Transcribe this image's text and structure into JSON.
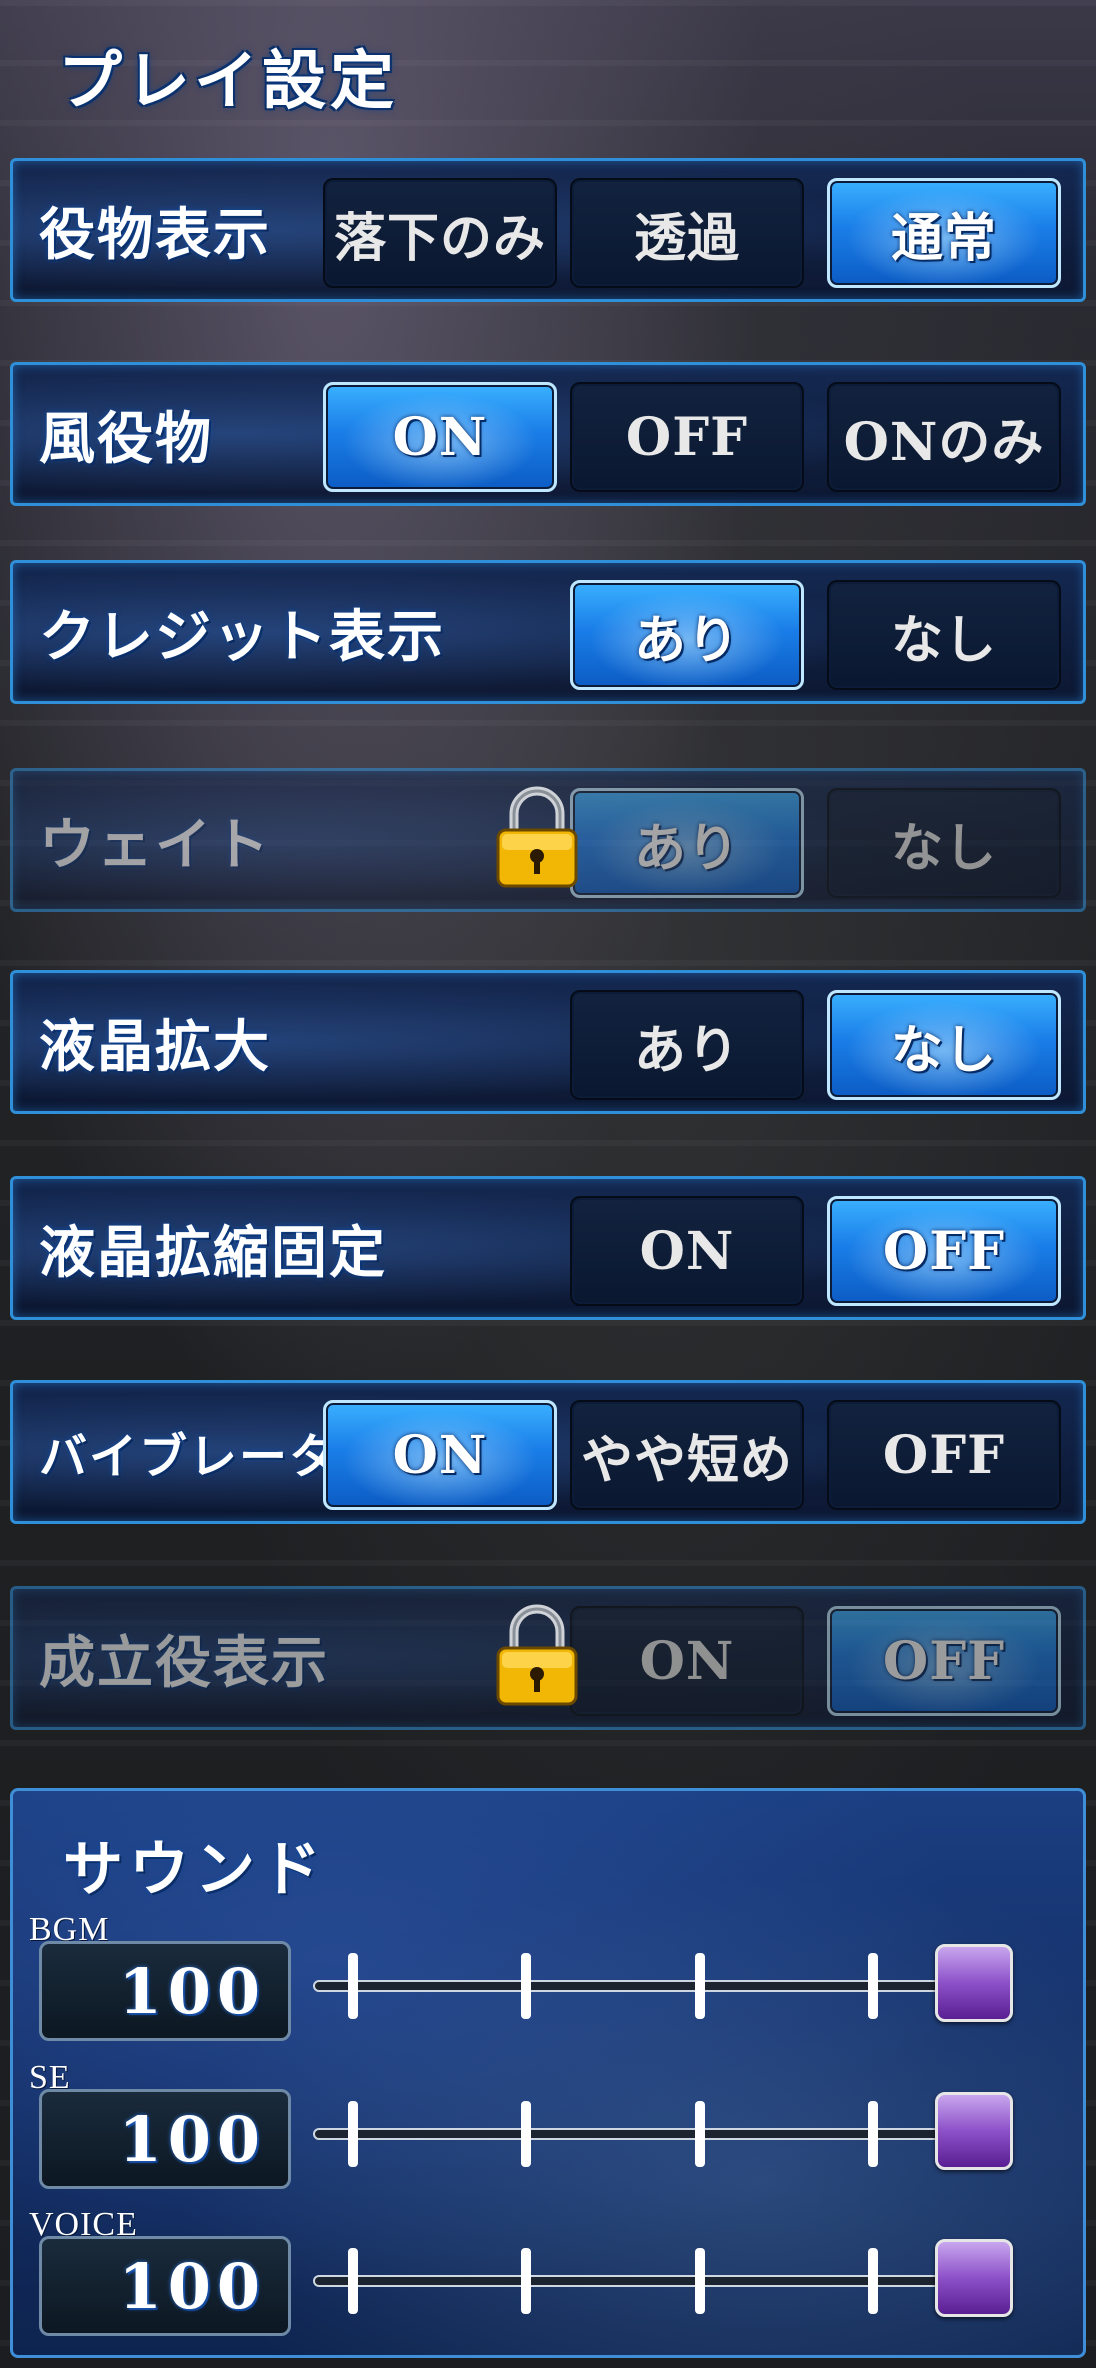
{
  "page_title": "プレイ設定",
  "rows": [
    {
      "label": "役物表示",
      "options": [
        "落下のみ",
        "透過",
        "通常"
      ],
      "selected": "通常"
    },
    {
      "label": "風役物",
      "options": [
        "ON",
        "OFF",
        "ONのみ"
      ],
      "selected": "ON"
    },
    {
      "label": "クレジット表示",
      "options": [
        "あり",
        "なし"
      ],
      "selected": "あり"
    },
    {
      "label": "ウェイト",
      "options": [
        "あり",
        "なし"
      ],
      "selected": "あり",
      "locked": true
    },
    {
      "label": "液晶拡大",
      "options": [
        "あり",
        "なし"
      ],
      "selected": "なし"
    },
    {
      "label": "液晶拡縮固定",
      "options": [
        "ON",
        "OFF"
      ],
      "selected": "OFF"
    },
    {
      "label": "バイブレータ",
      "options": [
        "ON",
        "やや短め",
        "OFF"
      ],
      "selected": "ON"
    },
    {
      "label": "成立役表示",
      "options": [
        "ON",
        "OFF"
      ],
      "selected": "OFF",
      "locked": true
    }
  ],
  "sound": {
    "title": "サウンド",
    "channels": [
      {
        "label": "BGM",
        "value": "100",
        "level": 1.0
      },
      {
        "label": "SE",
        "value": "100",
        "level": 1.0
      },
      {
        "label": "VOICE",
        "value": "100",
        "level": 1.0
      }
    ]
  },
  "colors": {
    "active_option": "#1a7ee8",
    "row_border": "#2f8fd8",
    "slider_knob": "#8c50c8"
  },
  "icons": {
    "lock": "padlock-icon"
  }
}
